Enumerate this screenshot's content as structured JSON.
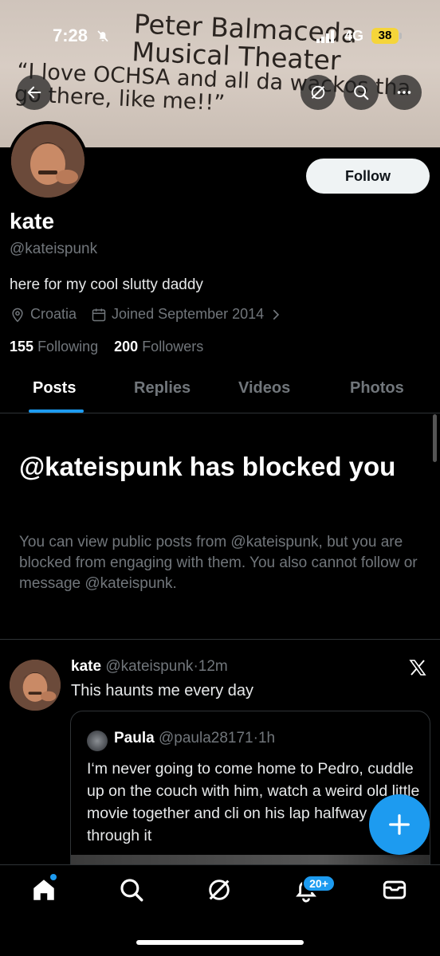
{
  "status_bar": {
    "time": "7:28",
    "network": "4G",
    "battery": "38"
  },
  "banner": {
    "line1": "Peter Balmaceda",
    "line2": "Musical Theater",
    "line3": "“I love OCHSA and all da wackos tha",
    "line4": "go there, like me!!”"
  },
  "profile": {
    "name": "kate",
    "handle": "@kateispunk",
    "bio": "here for my cool slutty daddy",
    "location": "Croatia",
    "joined": "Joined September 2014",
    "following_count": "155",
    "following_label": "Following",
    "followers_count": "200",
    "followers_label": "Followers",
    "follow_label": "Follow"
  },
  "tabs": [
    {
      "label": "Posts",
      "active": true
    },
    {
      "label": "Replies",
      "active": false
    },
    {
      "label": "Videos",
      "active": false
    },
    {
      "label": "Photos",
      "active": false
    }
  ],
  "blocked": {
    "title": "@kateispunk has blocked you",
    "message": "You can view public posts from @kateispunk, but you are blocked from engaging with them. You also cannot follow or message @kateispunk."
  },
  "post": {
    "author": "kate",
    "handle": "@kateispunk",
    "time": "12m",
    "text": "This haunts me every day",
    "quote": {
      "author": "Paula",
      "handle": "@paula28171",
      "time": "1h",
      "text": "I‘m never going to come home to Pedro, cuddle up on the couch with him, watch a weird old little movie together and cli on his lap halfway through it"
    }
  },
  "nav": {
    "notifications_badge": "20+"
  },
  "colors": {
    "accent": "#1d9bf0",
    "muted": "#71767b",
    "divider": "#2f3336"
  }
}
